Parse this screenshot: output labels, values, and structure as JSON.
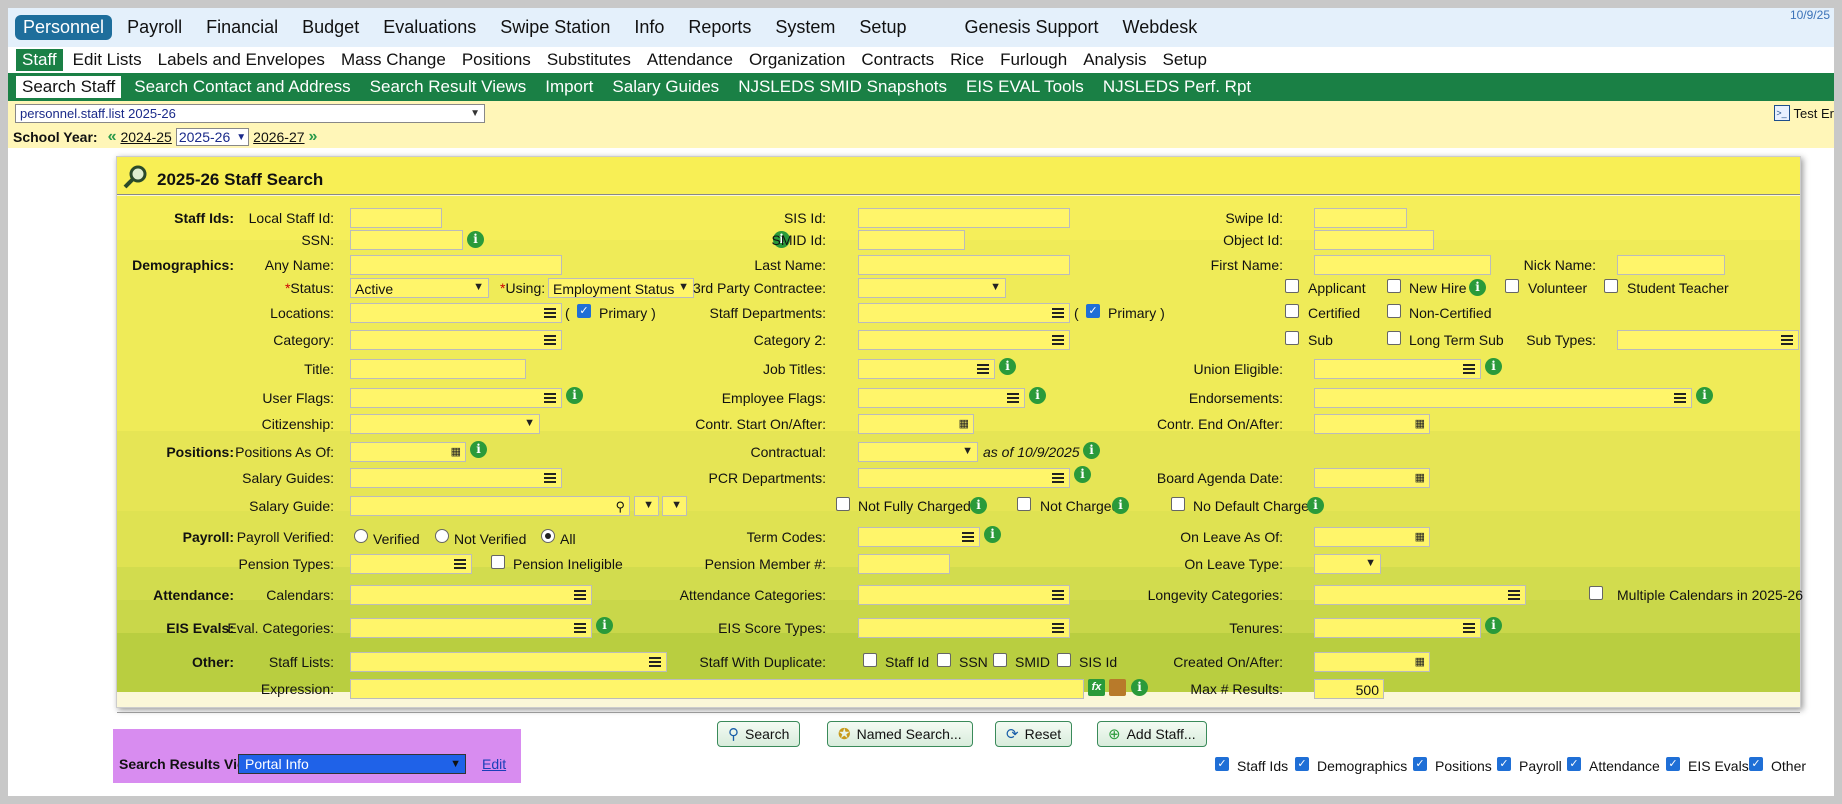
{
  "date": "10/9/25",
  "nav1": [
    "Personnel",
    "Payroll",
    "Financial",
    "Budget",
    "Evaluations",
    "Swipe Station",
    "Info",
    "Reports",
    "System",
    "Setup"
  ],
  "nav1b": [
    "Genesis Support",
    "Webdesk"
  ],
  "nav2": [
    "Staff",
    "Edit Lists",
    "Labels and Envelopes",
    "Mass Change",
    "Positions",
    "Substitutes",
    "Attendance",
    "Organization",
    "Contracts",
    "Rice",
    "Furlough",
    "Analysis",
    "Setup"
  ],
  "nav3": [
    "Search Staff",
    "Search Contact and Address",
    "Search Result Views",
    "Import",
    "Salary Guides",
    "NJSLEDS SMID Snapshots",
    "EIS EVAL Tools",
    "NJSLEDS Perf. Rpt"
  ],
  "path": "personnel.staff.list 2025-26",
  "test_env": "Test Er",
  "school_year": {
    "label": "School Year:",
    "prev": "2024-25",
    "current": "2025-26",
    "next": "2026-27"
  },
  "title": "2025-26 Staff Search",
  "s": {
    "staff_ids": "Staff Ids:",
    "local_staff_id": "Local Staff Id:",
    "sis_id": "SIS Id:",
    "swipe_id": "Swipe Id:",
    "ssn": "SSN:",
    "smid_id": "SMID Id:",
    "object_id": "Object Id:",
    "demographics": "Demographics:",
    "any_name": "Any Name:",
    "last_name": "Last Name:",
    "first_name": "First Name:",
    "nick_name": "Nick Name:",
    "status": "Status:",
    "status_val": "Active",
    "using": "Using:",
    "using_val": "Employment Status",
    "third_party": "3rd Party Contractee:",
    "applicant": "Applicant",
    "new_hire": "New Hire",
    "volunteer": "Volunteer",
    "student_teacher": "Student Teacher",
    "locations": "Locations:",
    "primary1": "Primary )",
    "staff_departments": "Staff Departments:",
    "primary2": "Primary )",
    "certified": "Certified",
    "non_certified": "Non-Certified",
    "category": "Category:",
    "category2": "Category 2:",
    "sub": "Sub",
    "long_term_sub": "Long Term Sub",
    "sub_types": "Sub Types:",
    "title_l": "Title:",
    "job_titles": "Job Titles:",
    "union_eligible": "Union Eligible:",
    "user_flags": "User Flags:",
    "employee_flags": "Employee Flags:",
    "endorsements": "Endorsements:",
    "citizenship": "Citizenship:",
    "contr_start": "Contr. Start On/After:",
    "contr_end": "Contr. End On/After:",
    "positions": "Positions:",
    "positions_as_of": "Positions As Of:",
    "contractual": "Contractual:",
    "as_of": "as of 10/9/2025",
    "salary_guides": "Salary Guides:",
    "pcr_departments": "PCR Departments:",
    "board_agenda_date": "Board Agenda Date:",
    "salary_guide": "Salary Guide:",
    "not_fully_charged": "Not Fully Charged",
    "not_charged": "Not Charged",
    "no_default_charge": "No Default Charge",
    "payroll": "Payroll:",
    "payroll_verified": "Payroll Verified:",
    "verified": "Verified",
    "not_verified": "Not Verified",
    "all": "All",
    "term_codes": "Term Codes:",
    "on_leave_as_of": "On Leave As Of:",
    "pension_types": "Pension Types:",
    "pension_ineligible": "Pension Ineligible",
    "pension_member": "Pension Member #:",
    "on_leave_type": "On Leave Type:",
    "attendance": "Attendance:",
    "calendars": "Calendars:",
    "attendance_categories": "Attendance Categories:",
    "longevity_categories": "Longevity Categories:",
    "multiple_calendars": "Multiple Calendars in 2025-26",
    "eis_evals": "EIS Evals:",
    "eval_categories": "Eval. Categories:",
    "eis_score_types": "EIS Score Types:",
    "tenures": "Tenures:",
    "other": "Other:",
    "staff_lists": "Staff Lists:",
    "staff_with_duplicate": "Staff With Duplicate:",
    "dup_staff_id": "Staff Id",
    "dup_ssn": "SSN",
    "dup_smid": "SMID",
    "dup_sis_id": "SIS Id",
    "created_on_after": "Created On/After:",
    "expression": "Expression:",
    "max_results": "Max # Results:",
    "max_results_val": "500"
  },
  "buttons": {
    "search": "Search",
    "named_search": "Named Search...",
    "reset": "Reset",
    "add_staff": "Add Staff..."
  },
  "srv": {
    "label": "Search Results View:",
    "value": "Portal Info",
    "edit": "Edit"
  },
  "sections": [
    "Staff Ids",
    "Demographics",
    "Positions",
    "Payroll",
    "Attendance",
    "EIS Evals",
    "Other"
  ],
  "info_glyph": "i",
  "fx_glyph": "fx",
  "check_glyph": "✓",
  "dd_glyph": "▼",
  "cal_glyph": "▦"
}
